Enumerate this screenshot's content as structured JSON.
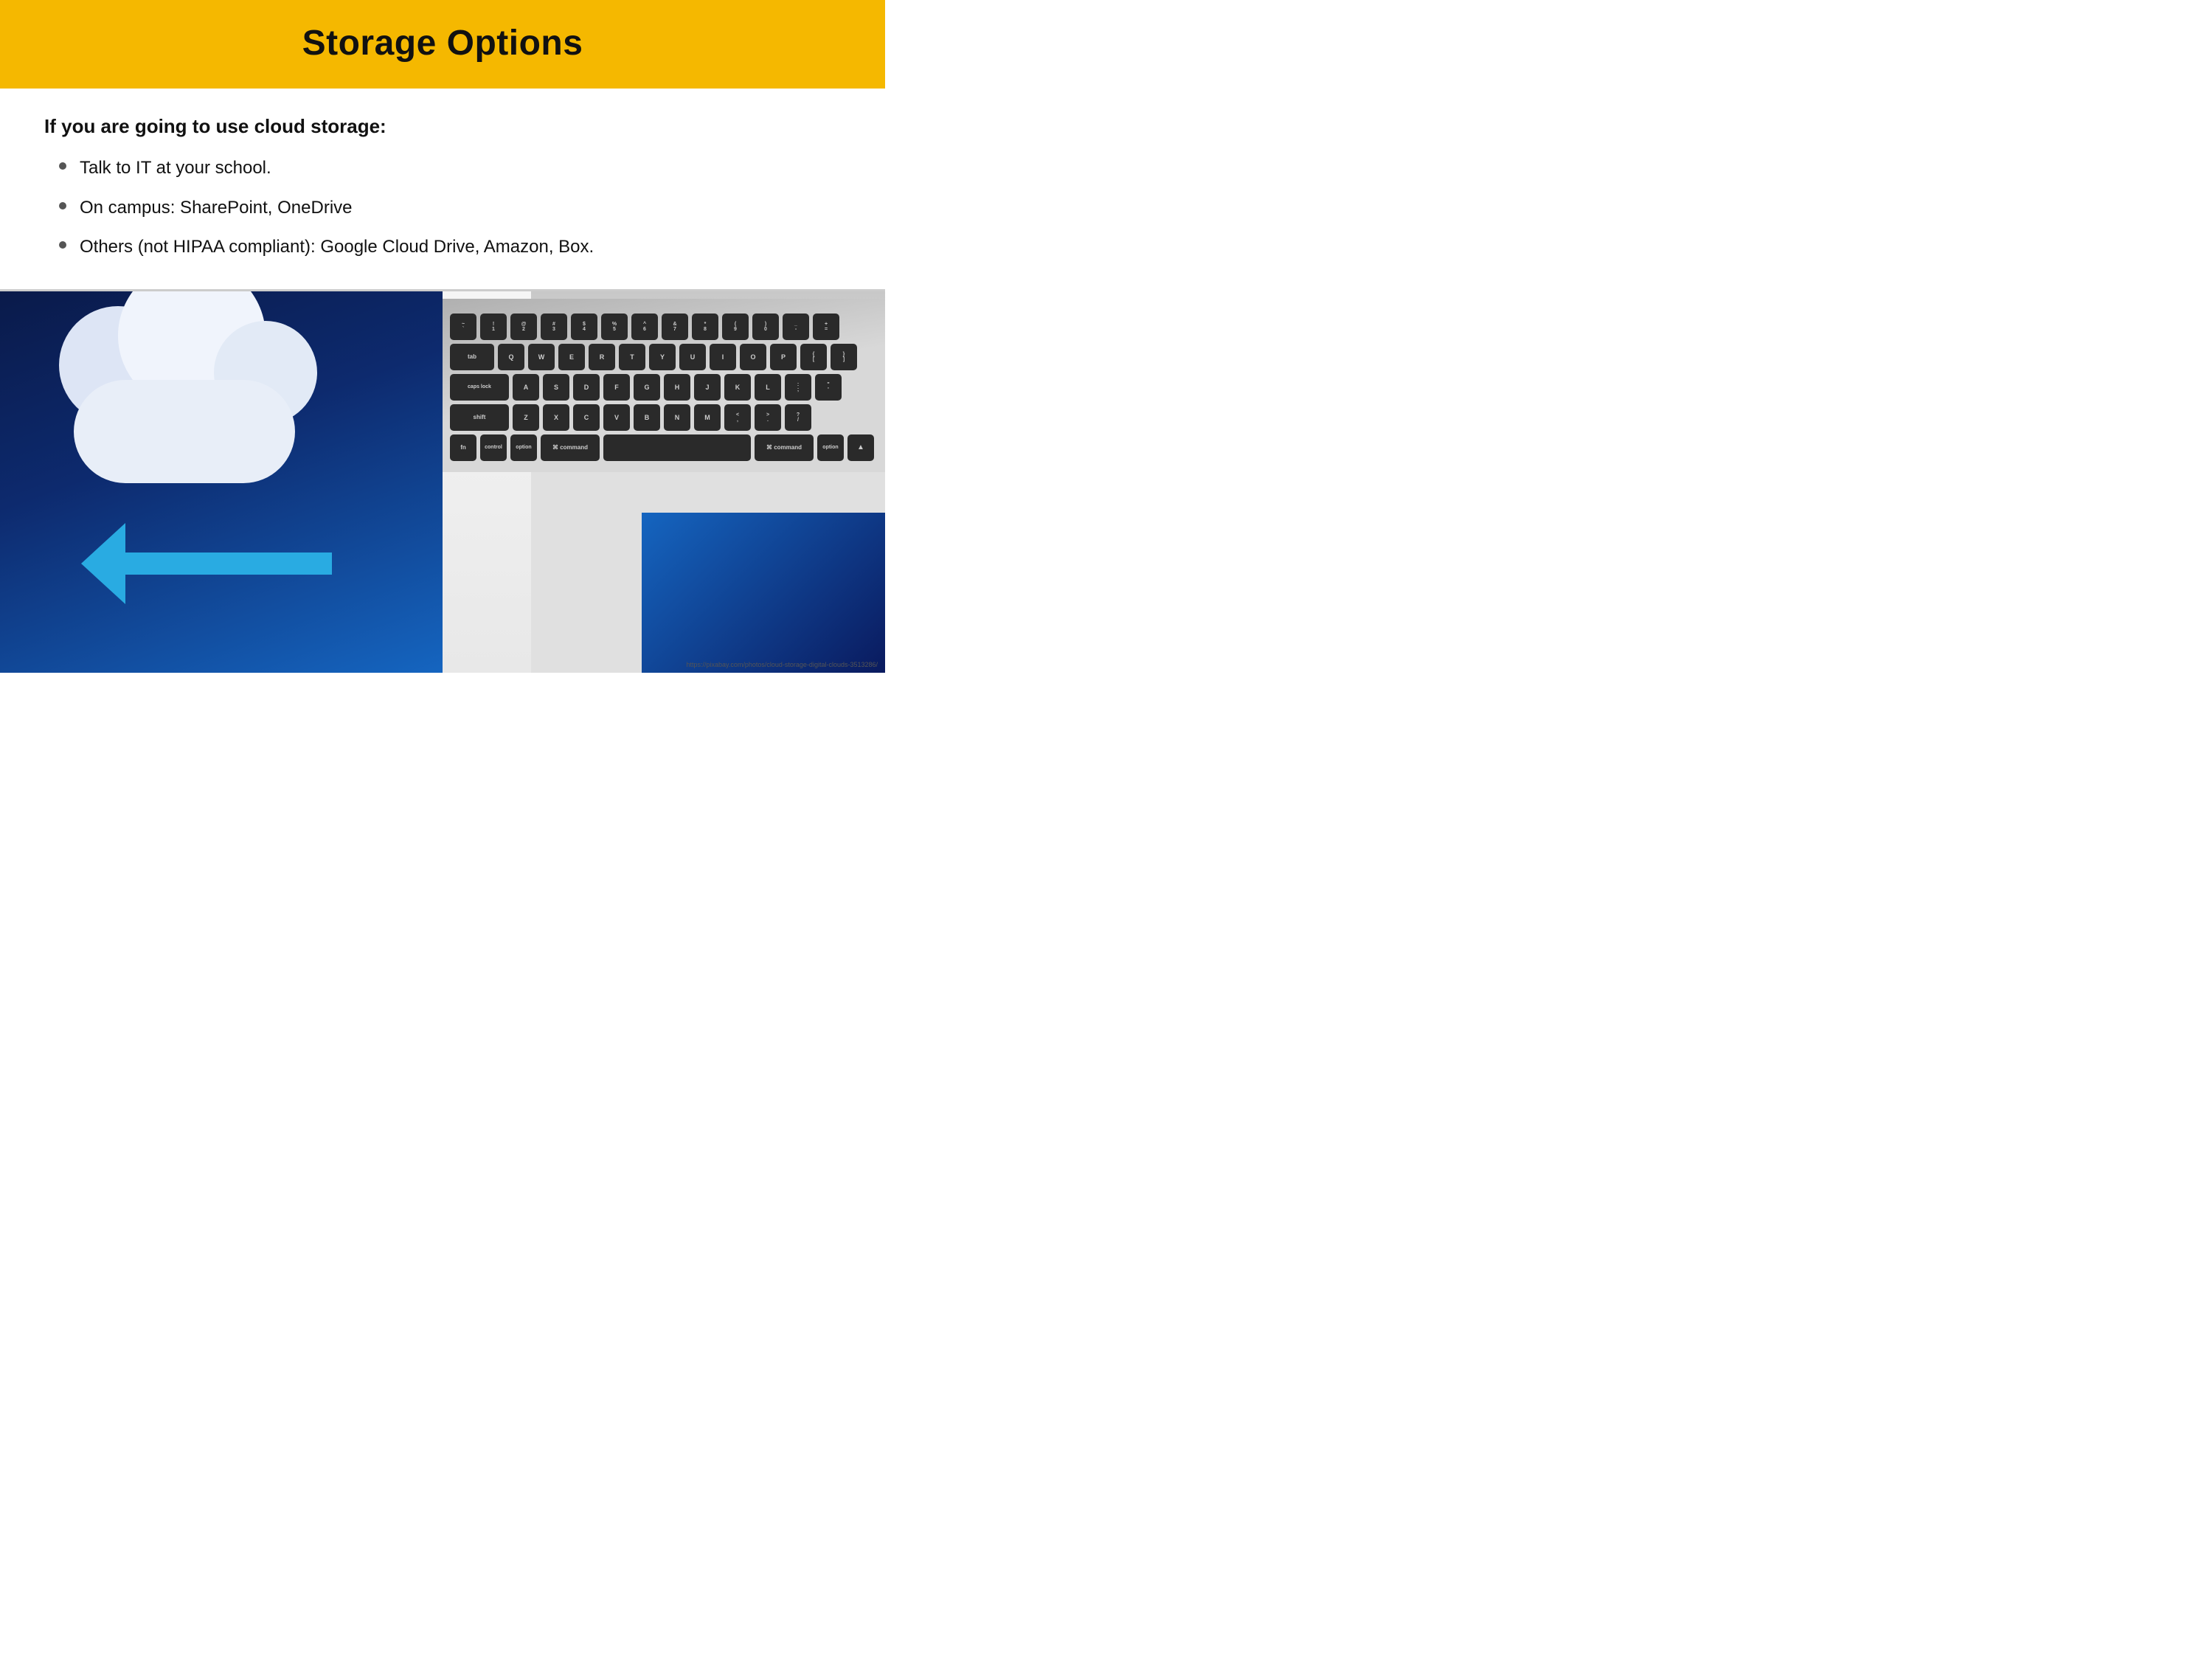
{
  "header": {
    "title": "Storage Options",
    "bg_color": "#F5B800"
  },
  "content": {
    "intro": "If you are going to use cloud storage:",
    "bullets": [
      "Talk to IT at your school.",
      "On campus: SharePoint, OneDrive",
      "Others (not HIPAA compliant): Google Cloud Drive, Amazon, Box."
    ]
  },
  "keyboard": {
    "rows": [
      [
        "~\n`",
        "!\n1",
        "@\n2",
        "#\n3",
        "$\n4",
        "%\n5",
        "^\n6",
        "&\n7",
        "*\n8",
        "(\n9",
        ")\n0",
        "_\n-",
        "+\n="
      ],
      [
        "Q",
        "W",
        "E",
        "R",
        "T",
        "Y",
        "U",
        "I",
        "O",
        "P",
        "{\n[",
        "}\n]"
      ],
      [
        "A",
        "S",
        "D",
        "F",
        "G",
        "H",
        "J",
        "K",
        "L",
        ":\n;",
        "\"\n'"
      ],
      [
        "Z",
        "X",
        "C",
        "V",
        "B",
        "N",
        "M",
        "<\n,",
        ">\n.",
        "?\n/"
      ]
    ]
  },
  "credit": "https://pixabay.com/photos/cloud-storage-digital-clouds-3513286/"
}
